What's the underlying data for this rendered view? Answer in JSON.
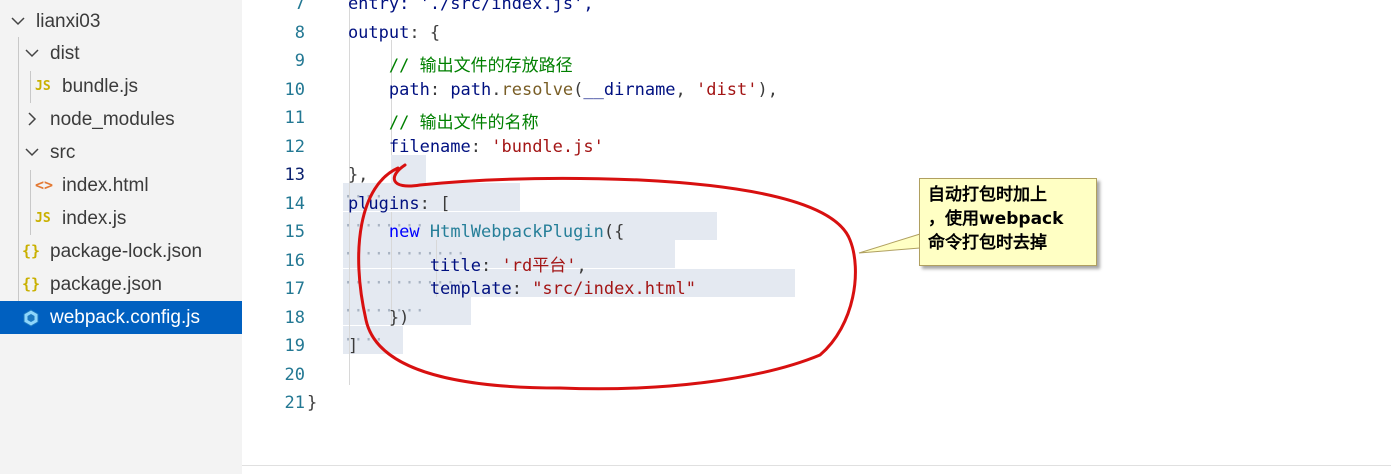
{
  "explorer": {
    "items": [
      {
        "label": "lianxi03",
        "type": "folder-open"
      },
      {
        "label": "dist",
        "type": "folder-open"
      },
      {
        "label": "bundle.js",
        "type": "js",
        "icon_text": "JS"
      },
      {
        "label": "node_modules",
        "type": "folder-closed"
      },
      {
        "label": "src",
        "type": "folder-open"
      },
      {
        "label": "index.html",
        "type": "html",
        "icon_text": "<>"
      },
      {
        "label": "index.js",
        "type": "js",
        "icon_text": "JS"
      },
      {
        "label": "package-lock.json",
        "type": "json",
        "icon_text": "{}"
      },
      {
        "label": "package.json",
        "type": "json",
        "icon_text": "{}"
      },
      {
        "label": "webpack.config.js",
        "type": "webpack",
        "selected": true
      }
    ]
  },
  "editor": {
    "current_line": "13",
    "lines": [
      {
        "n": "7",
        "tokens": [
          {
            "t": "    entry: './src/index.js',",
            "c": "p"
          }
        ]
      },
      {
        "n": "8",
        "tokens": [
          {
            "t": "    output",
            "c": "p"
          },
          {
            "t": ": {",
            "c": ""
          }
        ]
      },
      {
        "n": "9",
        "tokens": [
          {
            "t": "        // 输出文件的存放路径",
            "c": "c"
          }
        ]
      },
      {
        "n": "10",
        "tokens": [
          {
            "t": "        path",
            "c": "p"
          },
          {
            "t": ": ",
            "c": ""
          },
          {
            "t": "path",
            "c": "p"
          },
          {
            "t": ".",
            "c": ""
          },
          {
            "t": "resolve",
            "c": "f"
          },
          {
            "t": "(",
            "c": ""
          },
          {
            "t": "__dirname",
            "c": "p"
          },
          {
            "t": ", ",
            "c": ""
          },
          {
            "t": "'dist'",
            "c": "s"
          },
          {
            "t": "),",
            "c": ""
          }
        ]
      },
      {
        "n": "11",
        "tokens": [
          {
            "t": "        // 输出文件的名称",
            "c": "c"
          }
        ]
      },
      {
        "n": "12",
        "tokens": [
          {
            "t": "        filename",
            "c": "p"
          },
          {
            "t": ": ",
            "c": ""
          },
          {
            "t": "'bundle.js'",
            "c": "s"
          }
        ]
      },
      {
        "n": "13",
        "tokens": [
          {
            "t": "    },",
            "c": ""
          }
        ]
      },
      {
        "n": "14",
        "tokens": [
          {
            "t": "    plugins",
            "c": "p"
          },
          {
            "t": ": [",
            "c": ""
          }
        ]
      },
      {
        "n": "15",
        "tokens": [
          {
            "t": "        ",
            "c": ""
          },
          {
            "t": "new",
            "c": "k"
          },
          {
            "t": " ",
            "c": ""
          },
          {
            "t": "HtmlWebpackPlugin",
            "c": "t"
          },
          {
            "t": "({",
            "c": ""
          }
        ]
      },
      {
        "n": "16",
        "tokens": [
          {
            "t": "            title",
            "c": "p"
          },
          {
            "t": ": ",
            "c": ""
          },
          {
            "t": "'rd平台'",
            "c": "s"
          },
          {
            "t": ",",
            "c": ""
          }
        ]
      },
      {
        "n": "17",
        "tokens": [
          {
            "t": "            template",
            "c": "p"
          },
          {
            "t": ": ",
            "c": ""
          },
          {
            "t": "\"src/index.html\"",
            "c": "s"
          }
        ]
      },
      {
        "n": "18",
        "tokens": [
          {
            "t": "        })",
            "c": ""
          }
        ]
      },
      {
        "n": "19",
        "tokens": [
          {
            "t": "    ]",
            "c": ""
          }
        ]
      },
      {
        "n": "20",
        "tokens": []
      },
      {
        "n": "21",
        "tokens": [
          {
            "t": "}",
            "c": ""
          }
        ]
      }
    ]
  },
  "annotation": {
    "lines": [
      "自动打包时加上",
      "，使用webpack",
      "命令打包时去掉"
    ],
    "circle_color": "#dd0000",
    "note_bg": "#ffffc4"
  }
}
